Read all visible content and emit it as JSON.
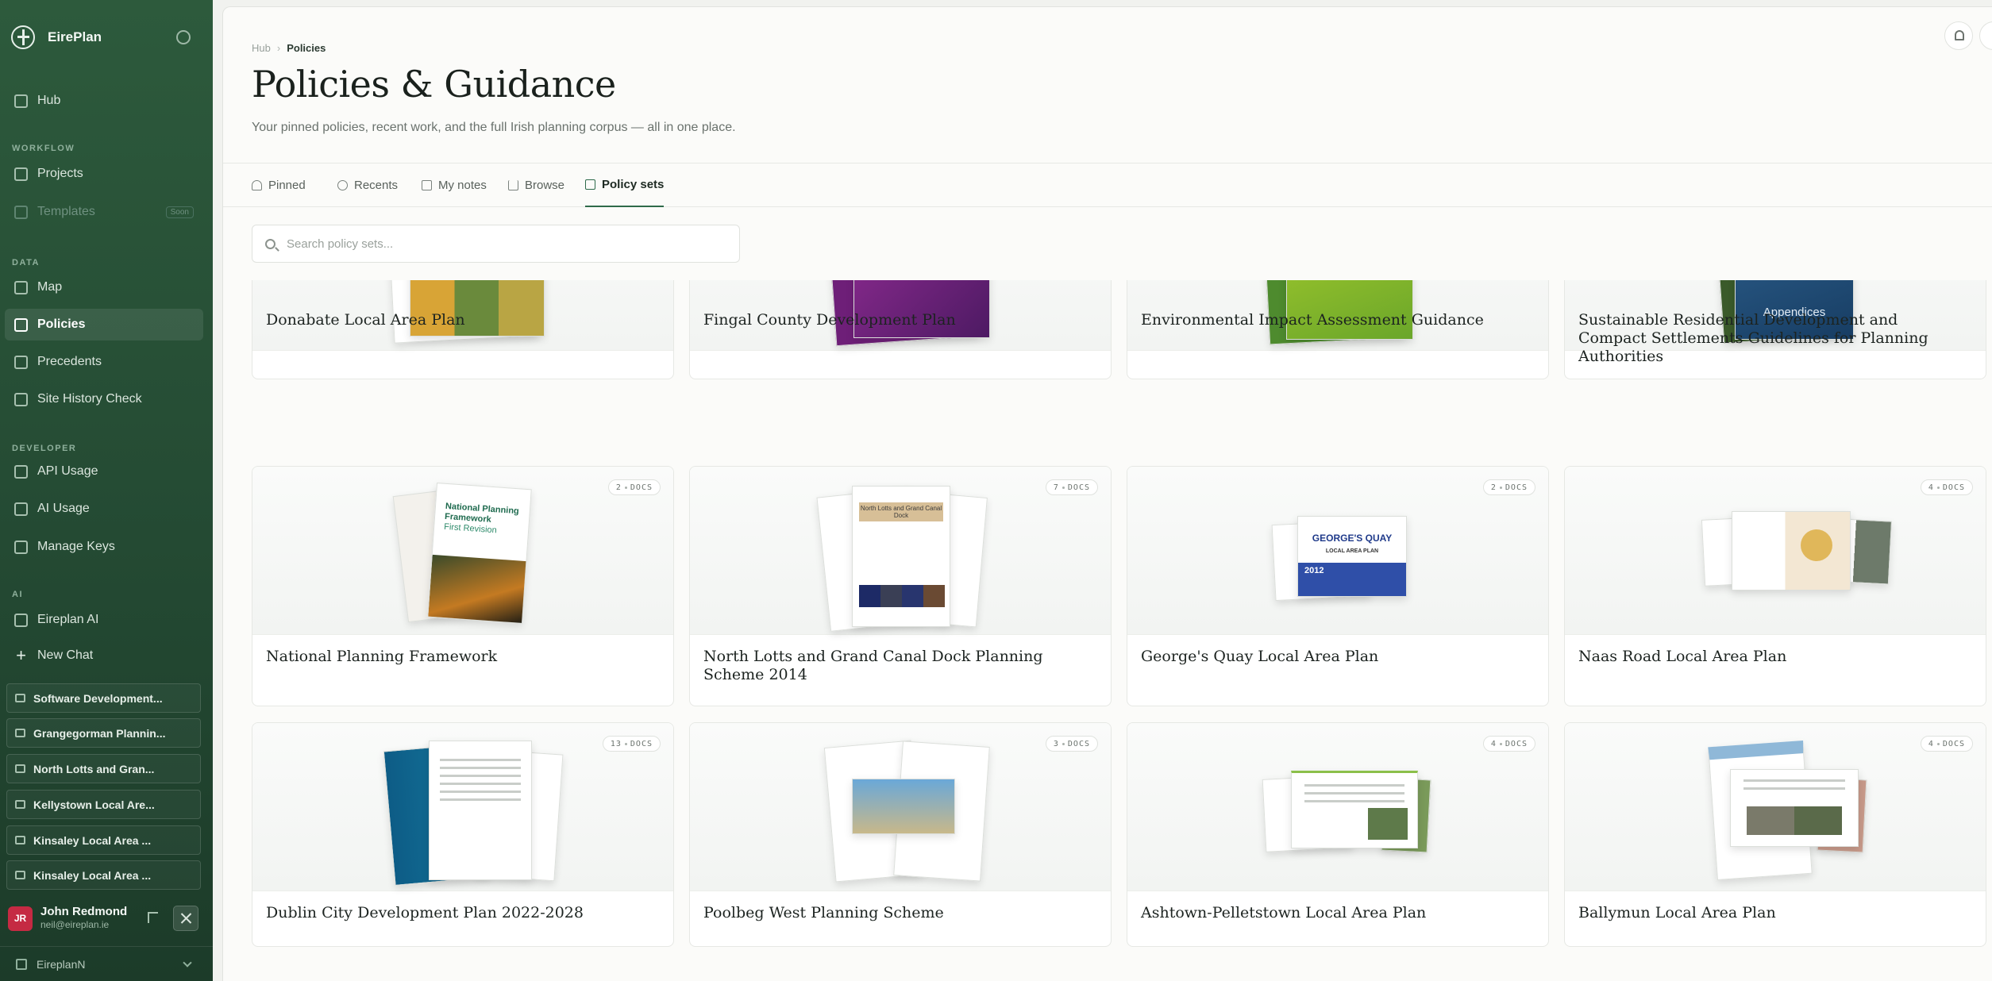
{
  "sidebar": {
    "brand": "EirePlan",
    "nav": {
      "hub": "Hub",
      "projects": "Projects",
      "templates": "Templates",
      "templates_badge": "Soon",
      "map": "Map",
      "policies": "Policies",
      "precedents": "Precedents",
      "site_history": "Site History Check",
      "api_usage": "API Usage",
      "ai_usage": "AI Usage",
      "manage_keys": "Manage Keys",
      "eireplan_ai": "Eireplan AI",
      "new_chat": "New Chat"
    },
    "sections": {
      "workflow": "WORKFLOW",
      "data": "DATA",
      "developer": "DEVELOPER",
      "ai": "AI"
    },
    "chats": [
      "Software Development...",
      "Grangegorman Plannin...",
      "North Lotts and Gran...",
      "Kellystown Local Are...",
      "Kinsaley Local Area ...",
      "Kinsaley Local Area ..."
    ],
    "user": {
      "initials": "JR",
      "name": "John Redmond",
      "email": "neil@eireplan.ie"
    },
    "workspace": "EireplanN",
    "colors": {
      "bg_top": "#2d5a3c",
      "bg_bottom": "#1c3b29",
      "avatar": "#c52a43"
    }
  },
  "header": {
    "breadcrumb": {
      "root": "Hub",
      "current": "Policies"
    },
    "title": "Policies & Guidance",
    "subtitle": "Your pinned policies, recent work, and the full Irish planning corpus — all in one place."
  },
  "tabs": [
    {
      "label": "Pinned",
      "icon": "star-icon"
    },
    {
      "label": "Recents",
      "icon": "clock-icon"
    },
    {
      "label": "My notes",
      "icon": "note-icon"
    },
    {
      "label": "Browse",
      "icon": "library-icon"
    },
    {
      "label": "Policy sets",
      "icon": "folder-icon",
      "active": true
    }
  ],
  "search": {
    "placeholder": "Search policy sets..."
  },
  "badge_unit": "DOCS",
  "cards": [
    {
      "title": "Donabate Local Area Plan",
      "docs": null
    },
    {
      "title": "Fingal County Development Plan",
      "docs": null
    },
    {
      "title": "Environmental Impact Assessment Guidance",
      "docs": null
    },
    {
      "title": "Sustainable Residential Development and Compact Settlements Guidelines for Planning Authorities",
      "docs": null
    },
    {
      "title": "National Planning Framework",
      "docs": "2"
    },
    {
      "title": "North Lotts and Grand Canal Dock Planning Scheme 2014",
      "docs": "7"
    },
    {
      "title": "George's Quay Local Area Plan",
      "docs": "2"
    },
    {
      "title": "Naas Road Local Area Plan",
      "docs": "4"
    },
    {
      "title": "Dublin City Development Plan 2022-2028",
      "docs": "13"
    },
    {
      "title": "Poolbeg West Planning Scheme",
      "docs": "3"
    },
    {
      "title": "Ashtown-Pelletstown Local Area Plan",
      "docs": "4"
    },
    {
      "title": "Ballymun Local Area Plan",
      "docs": "4"
    }
  ],
  "thumb_text": {
    "npf": "National Planning Framework",
    "npf_sub": "First Revision",
    "ngcd": "North Lotts and Grand Canal Dock",
    "gq_title": "GEORGE'S QUAY",
    "gq_sub": "LOCAL AREA PLAN",
    "gq_year": "2012",
    "srd": "Appendices"
  },
  "colors": {
    "accent": "#2e6a4a",
    "page_bg": "#fbfbf9",
    "avatar": "#c52a43"
  }
}
